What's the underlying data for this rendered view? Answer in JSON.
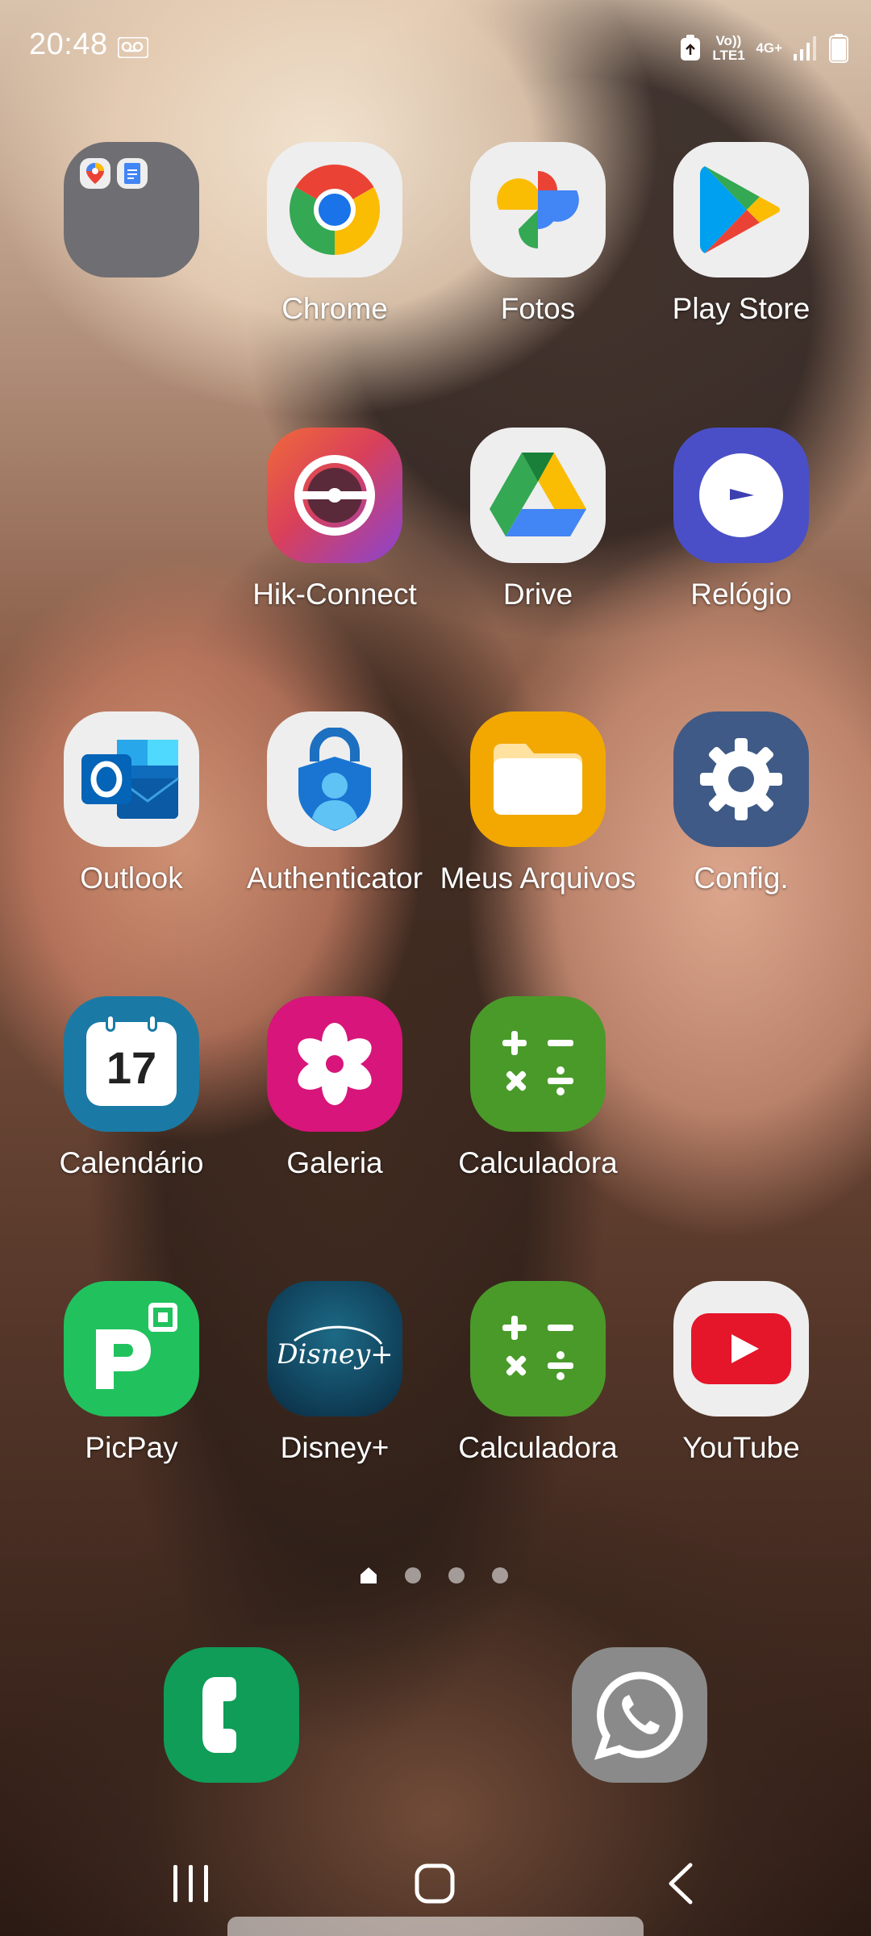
{
  "status_bar": {
    "time": "20:48",
    "network_lte": "Vo)) LTE1",
    "network_4g": "4G+",
    "icons": [
      "voicemail-icon",
      "data-saver-icon",
      "signal-icon",
      "battery-icon"
    ]
  },
  "apps": [
    {
      "id": "folder",
      "label": "",
      "icon": "folder-icon",
      "bg": "#6e6e73"
    },
    {
      "id": "chrome",
      "label": "Chrome",
      "icon": "chrome-icon",
      "bg": "#eeeeee"
    },
    {
      "id": "fotos",
      "label": "Fotos",
      "icon": "photos-pinwheel-icon",
      "bg": "#eeeeee"
    },
    {
      "id": "playstore",
      "label": "Play Store",
      "icon": "play-store-icon",
      "bg": "#eeeeee"
    },
    {
      "id": "hikconnect",
      "label": "Hik-Connect",
      "icon": "hik-connect-icon",
      "bg": "#d9405a"
    },
    {
      "id": "drive",
      "label": "Drive",
      "icon": "drive-icon",
      "bg": "#eeeeee"
    },
    {
      "id": "relogio",
      "label": "Relógio",
      "icon": "clock-icon",
      "bg": "#4a4fc7"
    },
    {
      "id": "outlook",
      "label": "Outlook",
      "icon": "outlook-icon",
      "bg": "#eeeeee"
    },
    {
      "id": "authenticator",
      "label": "Authenticator",
      "icon": "authenticator-icon",
      "bg": "#eeeeee"
    },
    {
      "id": "meusarquivos",
      "label": "Meus Arquivos",
      "icon": "folder-files-icon",
      "bg": "#f2a800"
    },
    {
      "id": "config",
      "label": "Config.",
      "icon": "gear-icon",
      "bg": "#3f5a86"
    },
    {
      "id": "calendario",
      "label": "Calendário",
      "icon": "calendar-icon",
      "bg": "#1a7aa5",
      "date": "17"
    },
    {
      "id": "galeria",
      "label": "Galeria",
      "icon": "gallery-flower-icon",
      "bg": "#d7157a"
    },
    {
      "id": "calculadora1",
      "label": "Calculadora",
      "icon": "calculator-icon",
      "bg": "#4a9a2a"
    },
    {
      "id": "picpay",
      "label": "PicPay",
      "icon": "picpay-icon",
      "bg": "#21c25e"
    },
    {
      "id": "disney",
      "label": "Disney+",
      "icon": "disney-plus-icon",
      "bg": "#114a68",
      "logo_text": "Disney+"
    },
    {
      "id": "calculadora2",
      "label": "Calculadora",
      "icon": "calculator-icon",
      "bg": "#4a9a2a"
    },
    {
      "id": "youtube",
      "label": "YouTube",
      "icon": "youtube-icon",
      "bg": "#eeeeee"
    }
  ],
  "dock": [
    {
      "id": "phone",
      "icon": "phone-icon",
      "bg": "#0f9d58"
    },
    {
      "id": "whatsapp",
      "icon": "whatsapp-icon",
      "bg": "#8a8a8a"
    }
  ],
  "page_indicator": {
    "pages": 4,
    "current": 0
  },
  "nav_bar": {
    "buttons": [
      "recents-button",
      "home-button",
      "back-button"
    ]
  }
}
